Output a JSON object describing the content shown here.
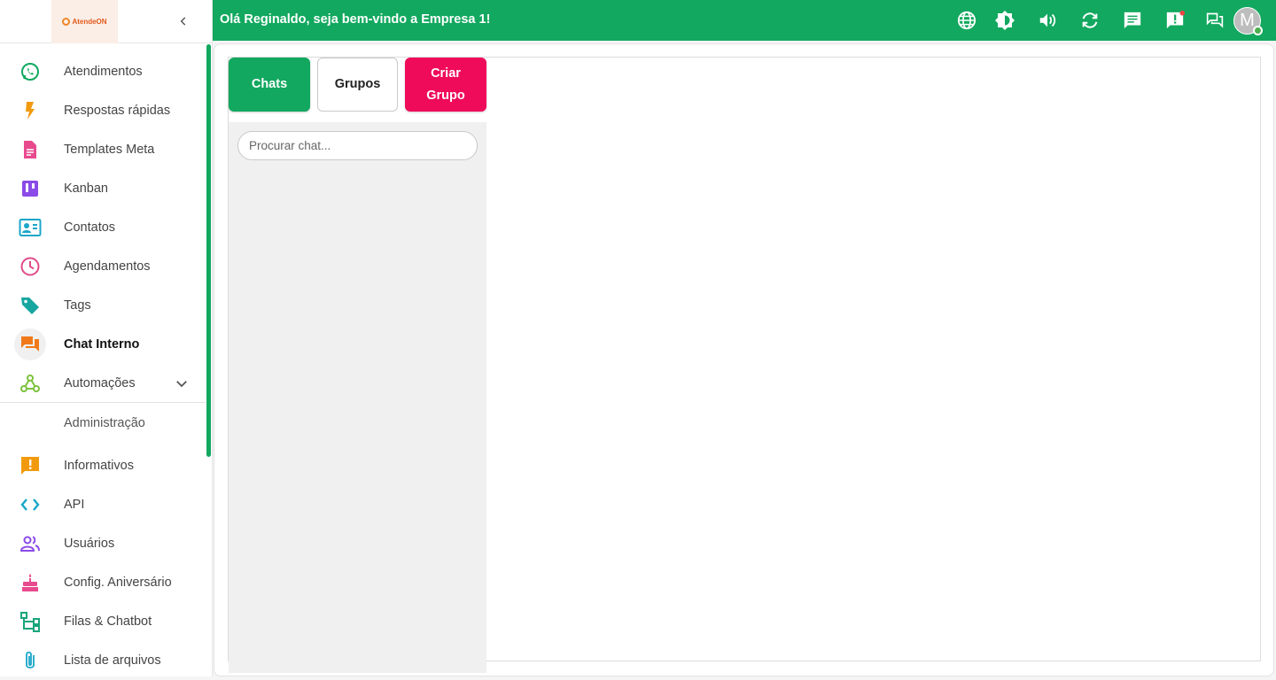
{
  "logo": {
    "text": "AtendeON"
  },
  "header": {
    "greeting": "Olá Reginaldo, seja bem-vindo a Empresa 1!",
    "avatar_initial": "M",
    "icons": [
      "globe-icon",
      "brightness-icon",
      "volume-icon",
      "sync-icon",
      "chat-icon",
      "alert-icon",
      "internal-chat-icon"
    ]
  },
  "sidebar": {
    "items": [
      {
        "label": "Atendimentos",
        "icon": "whatsapp-icon",
        "color": "#12a85f"
      },
      {
        "label": "Respostas rápidas",
        "icon": "flash-icon",
        "color": "#f29a0e"
      },
      {
        "label": "Templates Meta",
        "icon": "document-icon",
        "color": "#e84a8e"
      },
      {
        "label": "Kanban",
        "icon": "kanban-icon",
        "color": "#8b4be8"
      },
      {
        "label": "Contatos",
        "icon": "contact-card-icon",
        "color": "#1aa6c9"
      },
      {
        "label": "Agendamentos",
        "icon": "clock-icon",
        "color": "#e04b8a"
      },
      {
        "label": "Tags",
        "icon": "tag-icon",
        "color": "#17a5a0"
      },
      {
        "label": "Chat Interno",
        "icon": "forum-icon",
        "color": "#f07a1a"
      },
      {
        "label": "Automações",
        "icon": "webhook-icon",
        "color": "#7cc23c"
      }
    ],
    "section_title": "Administração",
    "admin_items": [
      {
        "label": "Informativos",
        "icon": "announcement-icon",
        "color": "#f29a0e"
      },
      {
        "label": "API",
        "icon": "code-icon",
        "color": "#1aa6c9"
      },
      {
        "label": "Usuários",
        "icon": "users-icon",
        "color": "#8b4be8"
      },
      {
        "label": "Config. Aniversário",
        "icon": "cake-icon",
        "color": "#e84a8e"
      },
      {
        "label": "Filas & Chatbot",
        "icon": "flowchart-icon",
        "color": "#17a57a"
      },
      {
        "label": "Lista de arquivos",
        "icon": "paperclip-icon",
        "color": "#1aa6c9"
      }
    ]
  },
  "main": {
    "tabs": {
      "chats": "Chats",
      "grupos": "Grupos",
      "criar_line1": "Criar",
      "criar_line2": "Grupo"
    },
    "search_placeholder": "Procurar chat..."
  },
  "colors": {
    "primary": "#12a85f",
    "accent": "#ef0b5a"
  }
}
